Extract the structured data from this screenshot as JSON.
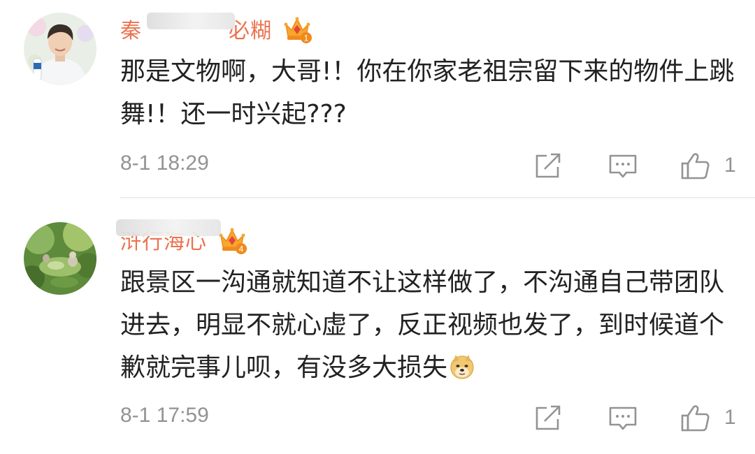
{
  "comments": [
    {
      "username": "秦　　　　必糊",
      "content": "那是文物啊，大哥!！你在你家老祖宗留下来的物件上跳舞!！还一时兴起???",
      "timestamp": "8-1 18:29",
      "likes": "1",
      "badge": "crown-level-1",
      "accent": "#eb7350"
    },
    {
      "username": "浒行海心",
      "content": "跟景区一沟通就知道不让这样做了，不沟通自己带团队进去，明显不就心虚了，反正视频也发了，到时候道个歉就完事儿呗，有没多大损失",
      "emoji": "doge-emoji",
      "timestamp": "8-1 17:59",
      "likes": "1",
      "badge": "crown-level-4",
      "accent": "#eb7350"
    }
  ],
  "icons": {
    "share": "share-icon",
    "reply": "reply-icon",
    "like": "thumbs-up-icon"
  }
}
